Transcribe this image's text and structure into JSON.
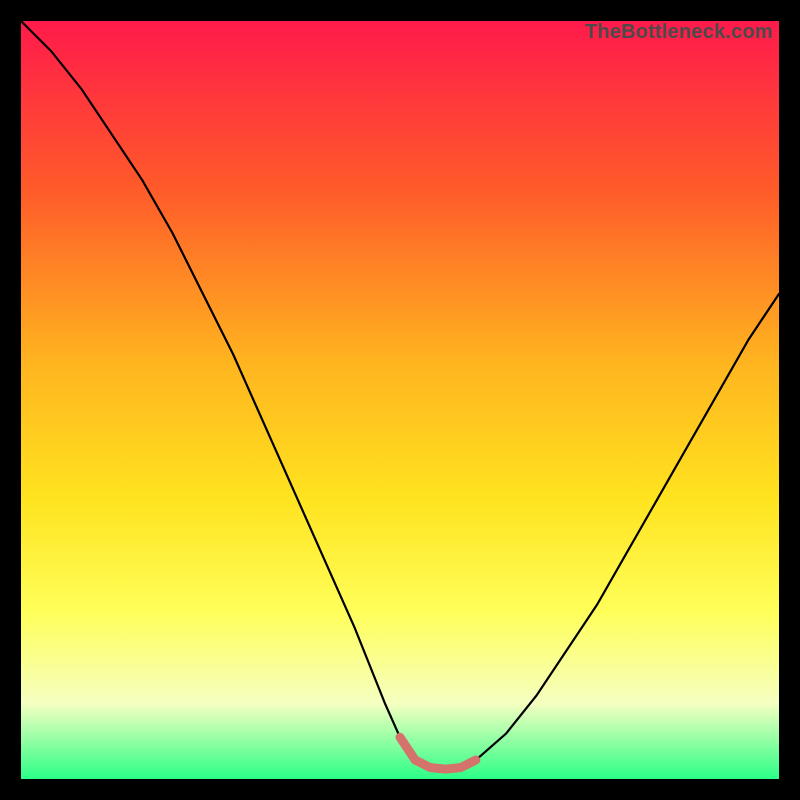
{
  "watermark": "TheBottleneck.com",
  "colors": {
    "frame": "#000000",
    "gradient_top": "#ff1a4b",
    "gradient_mid1": "#ff7a1f",
    "gradient_mid2": "#ffd21f",
    "gradient_mid3": "#ffff5a",
    "gradient_mid4": "#f2ffb0",
    "gradient_bottom": "#2bff86",
    "curve": "#000000",
    "highlight": "#d4736b"
  },
  "chart_data": {
    "type": "line",
    "title": "",
    "xlabel": "",
    "ylabel": "",
    "xlim": [
      0,
      100
    ],
    "ylim": [
      0,
      100
    ],
    "series": [
      {
        "name": "bottleneck-curve",
        "x": [
          0,
          4,
          8,
          12,
          16,
          20,
          24,
          28,
          32,
          36,
          40,
          44,
          48,
          50,
          52,
          54,
          56,
          58,
          60,
          64,
          68,
          72,
          76,
          80,
          84,
          88,
          92,
          96,
          100
        ],
        "values": [
          100,
          96,
          91,
          85,
          79,
          72,
          64,
          56,
          47,
          38,
          29,
          20,
          10,
          5.5,
          2.5,
          1.5,
          1.3,
          1.5,
          2.5,
          6,
          11,
          17,
          23,
          30,
          37,
          44,
          51,
          58,
          64
        ]
      }
    ],
    "highlight_range": {
      "x_start": 50,
      "x_end": 60,
      "note": "flat minimum region drawn thicker in muted red"
    }
  }
}
